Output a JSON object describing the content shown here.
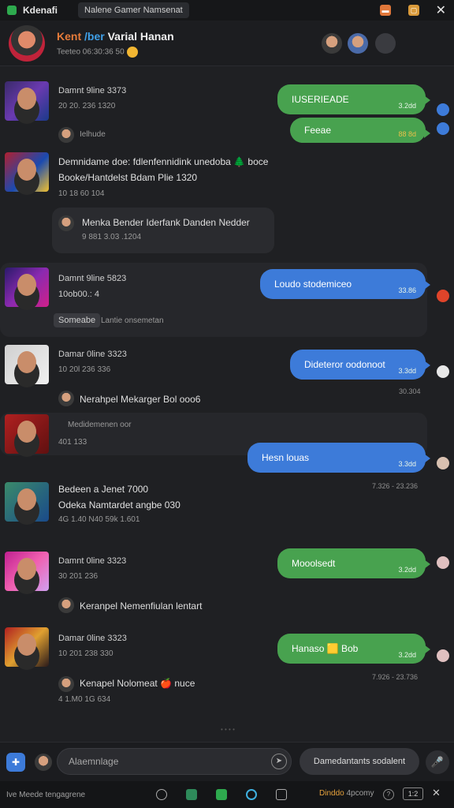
{
  "titlebar": {
    "app_name": "Kdenafi",
    "window_title": "Nalene Gamer Namsenat",
    "close_glyph": "✕"
  },
  "header": {
    "title_a": "Kent",
    "title_b": "/ber",
    "title_c": "Varial Hanan",
    "subtitle": "Teeteo 06:30:36 50"
  },
  "sections": [
    {
      "title": "Damnt 9line 3373",
      "meta": "20 20. 236 1320",
      "sub_name": "Ielhude"
    },
    {
      "title": "Demnidame doe: fdlenfennidink unedoba 🌲 boce",
      "line2": "Booke/Hantdelst Bdam Plie 1320",
      "meta": "10 18 60 104",
      "card_text": "Menka Bender Iderfank Danden Nedder",
      "card_meta": "9 881 3.03 .1204"
    },
    {
      "title": "Damnt 9line 5823",
      "meta": "10ob00.: 4",
      "pill": "Someabe",
      "pill_text": "Lantie onsemetan"
    },
    {
      "title": "Damar 0line 3323",
      "meta": "10 20l 236 336",
      "sub_name": "Nerahpel Mekarger Bol ooo6",
      "sub_meta": "Medidemenen oor",
      "meta2": "401 133"
    },
    {
      "title": "Bedeen a Jenet 7000",
      "line2": "Odeka Namtardet angbe 030",
      "meta": "4G 1.40 N40 59k 1.601"
    },
    {
      "title": "Damnt 0line 3323",
      "meta": "30 201 236",
      "sub_name": "Keranpel Nemenfiulan lentart"
    },
    {
      "title": "Damar 0line 3323",
      "meta": "10 201 238 330",
      "sub_name": "Kenapel Nolomeat 🍎 nuce",
      "sub_meta": "4 1.M0 1G 634"
    }
  ],
  "bubbles": [
    {
      "text": "IUSERIEADE",
      "time": "3.2dd"
    },
    {
      "text": "Feeae",
      "time": "88 8d"
    },
    {
      "text": "Loudo stodemiceo",
      "time": "33.86"
    },
    {
      "text": "Dideteror oodonoot",
      "time": "3.3dd"
    },
    {
      "text": "Hesn louas",
      "time": "3.3dd"
    },
    {
      "text": "Mooolsedt",
      "time": "3.2dd"
    },
    {
      "text": "Hanaso 🟨 Bob",
      "time": "3.2dd"
    }
  ],
  "right_times": [
    "30.304",
    "7.326 - 23.236",
    "7.926 - 23.736"
  ],
  "composer": {
    "placeholder": "Alaemnlage",
    "secondary_button": "Damedantants sodalent",
    "attach_glyph": "✚",
    "send_glyph": "➤",
    "mic_glyph": "🎤"
  },
  "statusbar": {
    "left": "Ive Meede tengagrene",
    "text_a": "Dinddo",
    "text_b": "4pcomy",
    "box_text": "1:2",
    "close_glyph": "✕"
  },
  "colors": {
    "bg": "#1f2023",
    "green_bubble": "#48a24f",
    "blue_bubble": "#3d7bd9",
    "accent_orange": "#e57b3a",
    "accent_blue": "#3fa0e8"
  },
  "icons": [
    "app-icon",
    "minimize-icon",
    "maximize-icon",
    "close-icon",
    "call-icon",
    "video-icon",
    "more-icon",
    "attach-icon",
    "send-icon",
    "mic-icon"
  ]
}
